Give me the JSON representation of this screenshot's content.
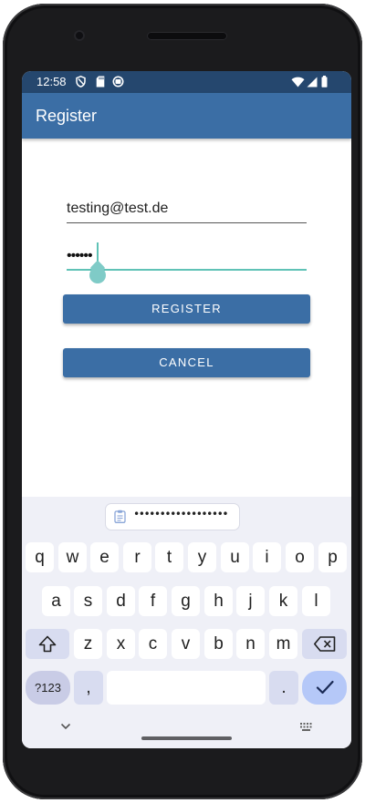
{
  "status_bar": {
    "time": "12:58",
    "left_icons": [
      "shield-icon",
      "sd-card-icon",
      "sync-icon"
    ],
    "right_icons": [
      "wifi-icon",
      "signal-icon",
      "battery-icon"
    ]
  },
  "app_bar": {
    "title": "Register"
  },
  "form": {
    "email_value": "testing@test.de",
    "password_value": "••••••",
    "register_label": "REGISTER",
    "cancel_label": "CANCEL"
  },
  "keyboard": {
    "suggestion": "••••••••••••••••••",
    "row1": [
      "q",
      "w",
      "e",
      "r",
      "t",
      "y",
      "u",
      "i",
      "o",
      "p"
    ],
    "row2": [
      "a",
      "s",
      "d",
      "f",
      "g",
      "h",
      "j",
      "k",
      "l"
    ],
    "row3": [
      "z",
      "x",
      "c",
      "v",
      "b",
      "n",
      "m"
    ],
    "symbols_label": "?123",
    "comma": ",",
    "period": "."
  },
  "colors": {
    "accent": "#3b6ea5",
    "status_bar": "#25476e",
    "focus": "#5fc2b6",
    "keyboard_bg": "#eff0f7"
  }
}
